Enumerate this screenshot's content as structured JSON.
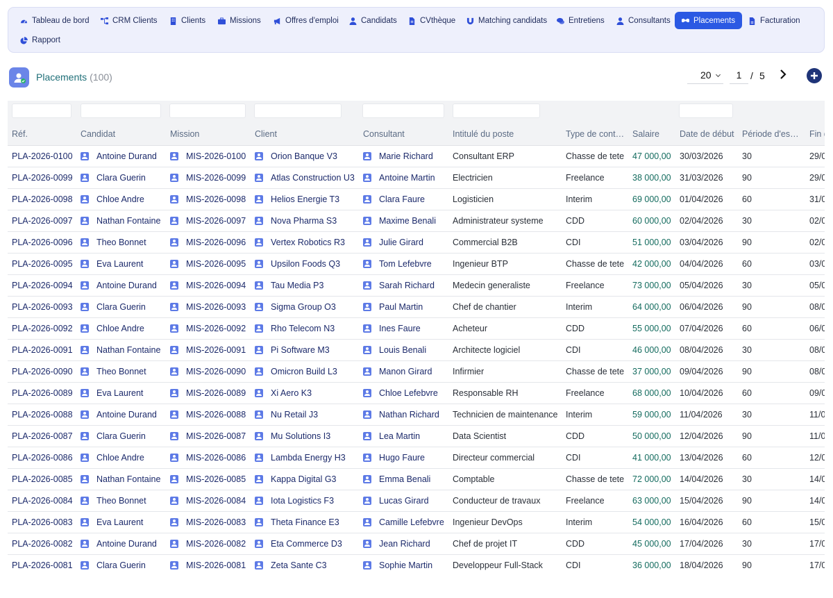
{
  "nav": {
    "items": [
      {
        "label": "Tableau de bord",
        "icon": "dashboard-gauge-icon"
      },
      {
        "label": "CRM Clients",
        "icon": "sitemap-icon"
      },
      {
        "label": "Clients",
        "icon": "building-icon"
      },
      {
        "label": "Missions",
        "icon": "briefcase-icon"
      },
      {
        "label": "Offres d'emploi",
        "icon": "megaphone-icon"
      },
      {
        "label": "Candidats",
        "icon": "user-tie-icon"
      },
      {
        "label": "CVthèque",
        "icon": "file-icon"
      },
      {
        "label": "Matching candidats",
        "icon": "magnet-icon"
      },
      {
        "label": "Entretiens",
        "icon": "comments-icon"
      },
      {
        "label": "Consultants",
        "icon": "user-tie-icon"
      },
      {
        "label": "Placements",
        "icon": "handshake-icon"
      },
      {
        "label": "Facturation",
        "icon": "file-invoice-icon"
      },
      {
        "label": "Rapport",
        "icon": "pie-chart-icon"
      }
    ],
    "active": "Placements",
    "accent": "#2b59e3"
  },
  "header": {
    "title": "Placements",
    "count": "(100)",
    "page_size": "20",
    "current_page": "1",
    "page_separator": "/",
    "total_pages": "5"
  },
  "table": {
    "columns": [
      "Réf.",
      "Candidat",
      "Mission",
      "Client",
      "Consultant",
      "Intitulé du poste",
      "Type de cont…",
      "Salaire",
      "Date de début",
      "Période d'es…",
      "Fin d…"
    ],
    "rows": [
      [
        "PLA-2026-0100",
        "Antoine Durand",
        "MIS-2026-0100",
        "Orion Banque V3",
        "Marie Richard",
        "Consultant ERP",
        "Chasse de tete",
        "47 000,00",
        "30/03/2026",
        "30",
        "29/0"
      ],
      [
        "PLA-2026-0099",
        "Clara Guerin",
        "MIS-2026-0099",
        "Atlas Construction U3",
        "Antoine Martin",
        "Electricien",
        "Freelance",
        "38 000,00",
        "31/03/2026",
        "90",
        "29/0"
      ],
      [
        "PLA-2026-0098",
        "Chloe Andre",
        "MIS-2026-0098",
        "Helios Energie T3",
        "Clara Faure",
        "Logisticien",
        "Interim",
        "69 000,00",
        "01/04/2026",
        "60",
        "31/0"
      ],
      [
        "PLA-2026-0097",
        "Nathan Fontaine",
        "MIS-2026-0097",
        "Nova Pharma S3",
        "Maxime Benali",
        "Administrateur systeme",
        "CDD",
        "60 000,00",
        "02/04/2026",
        "30",
        "02/0"
      ],
      [
        "PLA-2026-0096",
        "Theo Bonnet",
        "MIS-2026-0096",
        "Vertex Robotics R3",
        "Julie Girard",
        "Commercial B2B",
        "CDI",
        "51 000,00",
        "03/04/2026",
        "90",
        "02/0"
      ],
      [
        "PLA-2026-0095",
        "Eva Laurent",
        "MIS-2026-0095",
        "Upsilon Foods Q3",
        "Tom Lefebvre",
        "Ingenieur BTP",
        "Chasse de tete",
        "42 000,00",
        "04/04/2026",
        "60",
        "03/0"
      ],
      [
        "PLA-2026-0094",
        "Antoine Durand",
        "MIS-2026-0094",
        "Tau Media P3",
        "Sarah Richard",
        "Medecin generaliste",
        "Freelance",
        "73 000,00",
        "05/04/2026",
        "30",
        "05/0"
      ],
      [
        "PLA-2026-0093",
        "Clara Guerin",
        "MIS-2026-0093",
        "Sigma Group O3",
        "Paul Martin",
        "Chef de chantier",
        "Interim",
        "64 000,00",
        "06/04/2026",
        "90",
        "08/0"
      ],
      [
        "PLA-2026-0092",
        "Chloe Andre",
        "MIS-2026-0092",
        "Rho Telecom N3",
        "Ines Faure",
        "Acheteur",
        "CDD",
        "55 000,00",
        "07/04/2026",
        "60",
        "06/0"
      ],
      [
        "PLA-2026-0091",
        "Nathan Fontaine",
        "MIS-2026-0091",
        "Pi Software M3",
        "Louis Benali",
        "Architecte logiciel",
        "CDI",
        "46 000,00",
        "08/04/2026",
        "30",
        "08/0"
      ],
      [
        "PLA-2026-0090",
        "Theo Bonnet",
        "MIS-2026-0090",
        "Omicron Build L3",
        "Manon Girard",
        "Infirmier",
        "Chasse de tete",
        "37 000,00",
        "09/04/2026",
        "90",
        "08/0"
      ],
      [
        "PLA-2026-0089",
        "Eva Laurent",
        "MIS-2026-0089",
        "Xi Aero K3",
        "Chloe Lefebvre",
        "Responsable RH",
        "Freelance",
        "68 000,00",
        "10/04/2026",
        "60",
        "09/0"
      ],
      [
        "PLA-2026-0088",
        "Antoine Durand",
        "MIS-2026-0088",
        "Nu Retail J3",
        "Nathan Richard",
        "Technicien de maintenance",
        "Interim",
        "59 000,00",
        "11/04/2026",
        "30",
        "11/0"
      ],
      [
        "PLA-2026-0087",
        "Clara Guerin",
        "MIS-2026-0087",
        "Mu Solutions I3",
        "Lea Martin",
        "Data Scientist",
        "CDD",
        "50 000,00",
        "12/04/2026",
        "90",
        "11/0"
      ],
      [
        "PLA-2026-0086",
        "Chloe Andre",
        "MIS-2026-0086",
        "Lambda Energy H3",
        "Hugo Faure",
        "Directeur commercial",
        "CDI",
        "41 000,00",
        "13/04/2026",
        "60",
        "12/0"
      ],
      [
        "PLA-2026-0085",
        "Nathan Fontaine",
        "MIS-2026-0085",
        "Kappa Digital G3",
        "Emma Benali",
        "Comptable",
        "Chasse de tete",
        "72 000,00",
        "14/04/2026",
        "30",
        "14/0"
      ],
      [
        "PLA-2026-0084",
        "Theo Bonnet",
        "MIS-2026-0084",
        "Iota Logistics F3",
        "Lucas Girard",
        "Conducteur de travaux",
        "Freelance",
        "63 000,00",
        "15/04/2026",
        "90",
        "14/0"
      ],
      [
        "PLA-2026-0083",
        "Eva Laurent",
        "MIS-2026-0083",
        "Theta Finance E3",
        "Camille Lefebvre",
        "Ingenieur DevOps",
        "Interim",
        "54 000,00",
        "16/04/2026",
        "60",
        "15/0"
      ],
      [
        "PLA-2026-0082",
        "Antoine Durand",
        "MIS-2026-0082",
        "Eta Commerce D3",
        "Jean Richard",
        "Chef de projet IT",
        "CDD",
        "45 000,00",
        "17/04/2026",
        "30",
        "17/0"
      ],
      [
        "PLA-2026-0081",
        "Clara Guerin",
        "MIS-2026-0081",
        "Zeta Sante C3",
        "Sophie Martin",
        "Developpeur Full-Stack",
        "CDI",
        "36 000,00",
        "18/04/2026",
        "90",
        "17/0"
      ]
    ],
    "colors": {
      "link": "#1c2a6b",
      "money": "#136b5e",
      "header_text": "#5b6b84",
      "person_icon": "#5d7ae6"
    }
  }
}
